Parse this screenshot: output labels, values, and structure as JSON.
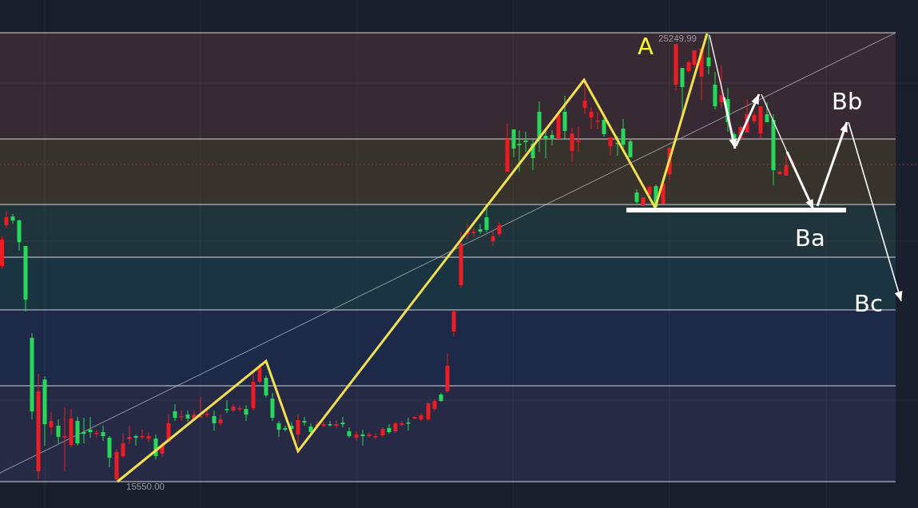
{
  "chart": {
    "wave_labels": [
      {
        "text": "A",
        "color": "#ffff22"
      },
      {
        "text": "Bb",
        "color": "#ffffff"
      },
      {
        "text": "Ba",
        "color": "#ffffff"
      },
      {
        "text": "Bc",
        "color": "#ffffff"
      }
    ],
    "price_labels": [
      {
        "text": "25249.99"
      },
      {
        "text": "15550.00"
      }
    ]
  }
}
